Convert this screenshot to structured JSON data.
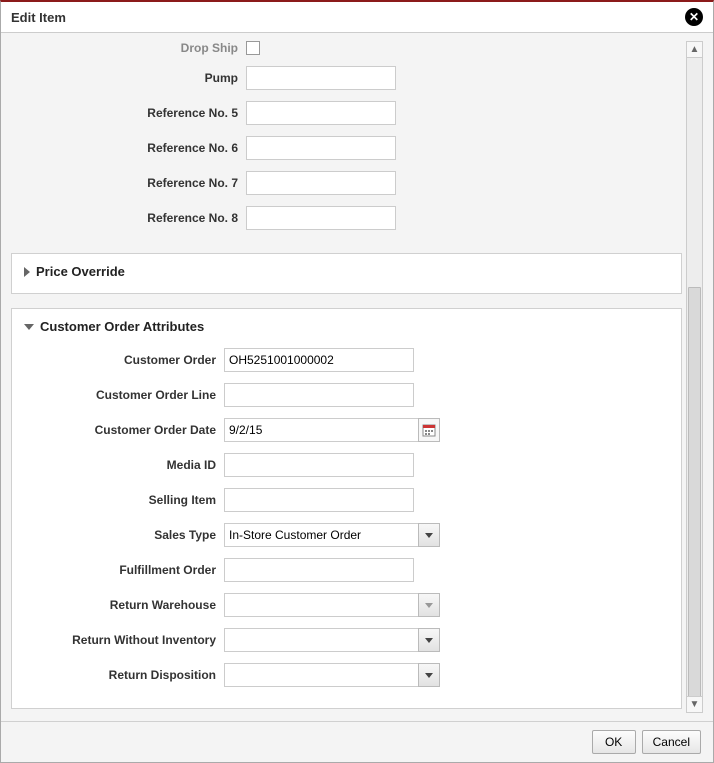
{
  "dialog": {
    "title": "Edit Item"
  },
  "upper": {
    "dropShipLabel": "Drop Ship",
    "pumpLabel": "Pump",
    "ref5Label": "Reference No. 5",
    "ref6Label": "Reference No. 6",
    "ref7Label": "Reference No. 7",
    "ref8Label": "Reference No. 8",
    "pump": "",
    "ref5": "",
    "ref6": "",
    "ref7": "",
    "ref8": ""
  },
  "sections": {
    "priceOverrideTitle": "Price Override",
    "customerOrderAttrsTitle": "Customer Order Attributes"
  },
  "cust": {
    "orderLabel": "Customer Order",
    "order": "OH5251001000002",
    "lineLabel": "Customer Order Line",
    "line": "",
    "dateLabel": "Customer Order Date",
    "date": "9/2/15",
    "mediaLabel": "Media ID",
    "media": "",
    "sellingItemLabel": "Selling Item",
    "sellingItem": "",
    "salesTypeLabel": "Sales Type",
    "salesType": "In-Store Customer Order",
    "fulfillmentLabel": "Fulfillment Order",
    "fulfillment": "",
    "returnWhLabel": "Return Warehouse",
    "returnWh": "",
    "rwiLabel": "Return Without Inventory",
    "rwi": "",
    "dispLabel": "Return Disposition",
    "disp": ""
  },
  "footer": {
    "ok": "OK",
    "cancel": "Cancel"
  }
}
